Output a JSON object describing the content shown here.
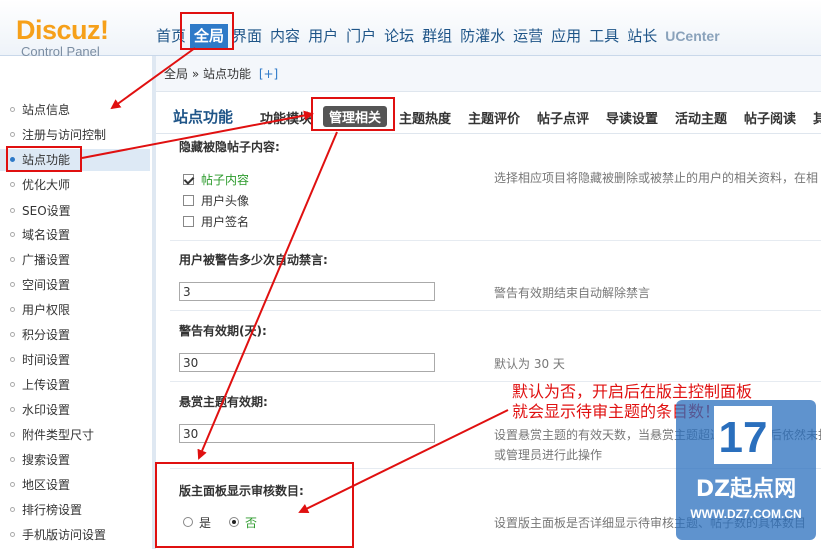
{
  "logo": {
    "main": "Discuz!",
    "sub": "Control Panel"
  },
  "topnav": [
    {
      "label": "首页",
      "active": false
    },
    {
      "label": "全局",
      "active": true
    },
    {
      "label": "界面",
      "active": false
    },
    {
      "label": "内容",
      "active": false
    },
    {
      "label": "用户",
      "active": false
    },
    {
      "label": "门户",
      "active": false
    },
    {
      "label": "论坛",
      "active": false
    },
    {
      "label": "群组",
      "active": false
    },
    {
      "label": "防灌水",
      "active": false
    },
    {
      "label": "运营",
      "active": false
    },
    {
      "label": "应用",
      "active": false
    },
    {
      "label": "工具",
      "active": false
    },
    {
      "label": "站长",
      "active": false
    },
    {
      "label": "UCenter",
      "active": false
    }
  ],
  "breadcrumb": {
    "path": "全局 » 站点功能",
    "plus": "[+]"
  },
  "sidebar": {
    "items": [
      "站点信息",
      "注册与访问控制",
      "站点功能",
      "优化大师",
      "SEO设置",
      "域名设置",
      "广播设置",
      "空间设置",
      "用户权限",
      "积分设置",
      "时间设置",
      "上传设置",
      "水印设置",
      "附件类型尺寸",
      "搜索设置",
      "地区设置",
      "排行榜设置",
      "手机版访问设置"
    ],
    "active_index": 2
  },
  "subtabs": {
    "title": "站点功能",
    "items": [
      "功能模块",
      "管理相关",
      "主题热度",
      "主题评价",
      "帖子点评",
      "导读设置",
      "活动主题",
      "帖子阅读",
      "其"
    ],
    "active_index": 1
  },
  "form": {
    "hide_posts": {
      "label": "隐藏被隐帖子内容:",
      "options": [
        {
          "label": "帖子内容",
          "checked": true
        },
        {
          "label": "用户头像",
          "checked": false
        },
        {
          "label": "用户签名",
          "checked": false
        }
      ],
      "hint": "选择相应项目将隐藏被删除或被禁止的用户的相关资料，在相"
    },
    "warn_count": {
      "label": "用户被警告多少次自动禁言:",
      "value": "3",
      "hint": "警告有效期结束自动解除禁言"
    },
    "warn_expire": {
      "label": "警告有效期(天):",
      "value": "30",
      "hint": "默认为 30 天"
    },
    "reward_expire": {
      "label": "悬赏主题有效期:",
      "value": "30",
      "hint1": "设置悬赏主题的有效天数，当悬赏主题超过有效天数后依然未找",
      "hint2": "或管理员进行此操作"
    },
    "moderator_panel": {
      "label": "版主面板显示审核数目:",
      "yes": "是",
      "no": "否",
      "selected": "no",
      "hint": "设置版主面板是否详细显示待审核主题、帖子数的具体数目"
    }
  },
  "annotation": {
    "line1": "默认为否，开启后在版主控制面板",
    "line2": "就会显示待审主题的条目数！"
  },
  "watermark": {
    "badge": "17",
    "brand": "DZ起点网",
    "url": "WWW.DZ7.COM.CN"
  },
  "colors": {
    "accent": "#2e7ac8",
    "annotation": "#e01010",
    "logo": "#f6a01a",
    "watermark": "#2a6fbd"
  }
}
